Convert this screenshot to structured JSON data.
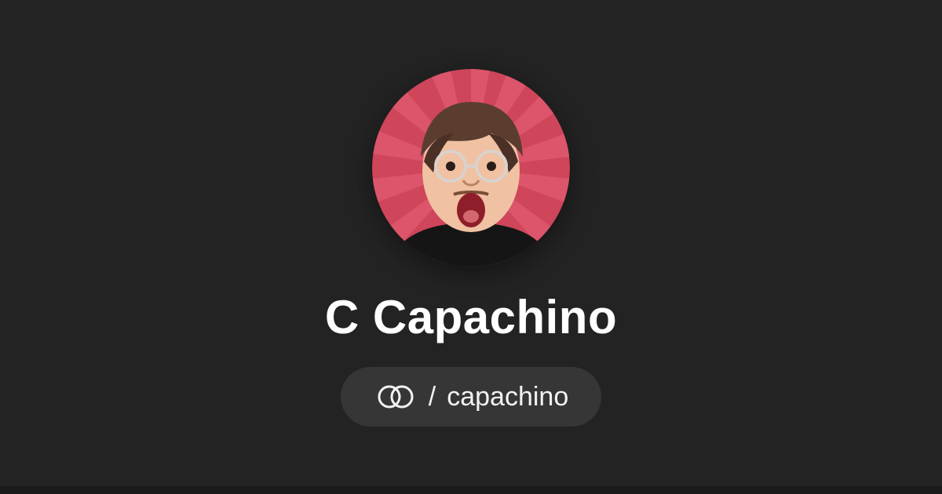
{
  "profile": {
    "display_name": "C Capachino",
    "avatar_description_icon": "profile-avatar-image"
  },
  "handle": {
    "separator": "/",
    "username": "capachino",
    "brand_icon": "linked-rings-icon"
  },
  "colors": {
    "background": "#232323",
    "pill_background": "#363636",
    "text": "#ffffff",
    "avatar_burst": "#d8485d"
  }
}
